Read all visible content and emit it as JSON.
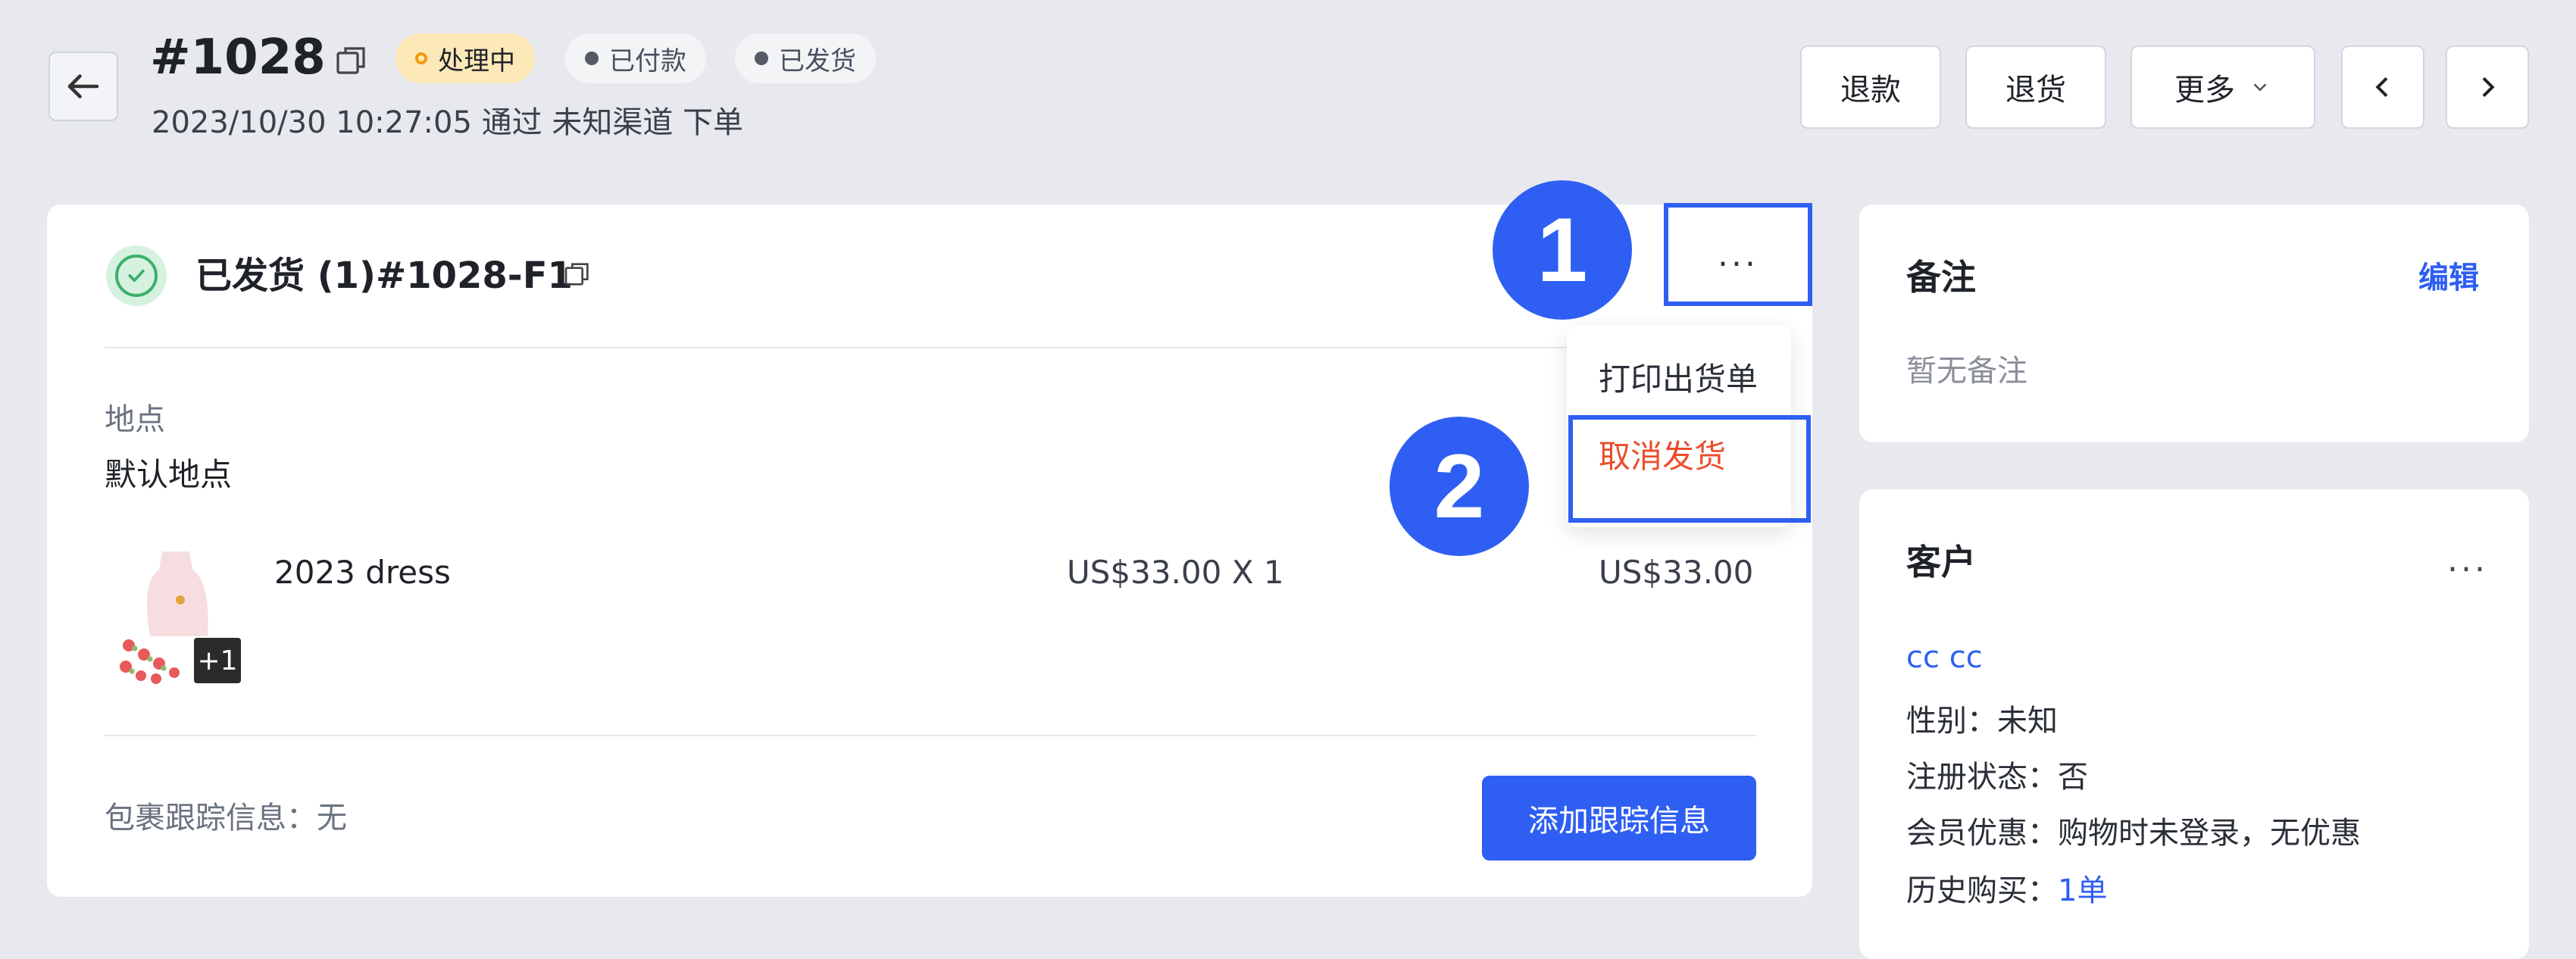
{
  "header": {
    "order_number": "#1028",
    "status_processing": "处理中",
    "status_paid": "已付款",
    "status_shipped": "已发货",
    "subline": "2023/10/30 10:27:05 通过 未知渠道 下单",
    "buttons": {
      "refund": "退款",
      "return": "退货",
      "more": "更多"
    }
  },
  "fulfillment": {
    "title": "已发货 (1)#1028-F1",
    "location_label": "地点",
    "location_value": "默认地点",
    "product": {
      "name": "2023 dress",
      "badge": "+1",
      "unit_price": "US$33.00 X 1",
      "total": "US$33.00"
    },
    "tracking_label": "包裹跟踪信息：无",
    "add_tracking_button": "添加跟踪信息"
  },
  "dropdown": {
    "trigger": "...",
    "items": [
      "打印出货单",
      "取消发货"
    ]
  },
  "annotations": {
    "step1": "1",
    "step2": "2"
  },
  "notes": {
    "title": "备注",
    "edit": "编辑",
    "empty": "暂无备注"
  },
  "customer": {
    "title": "客户",
    "more": "...",
    "name": "cc cc",
    "gender": "性别：未知",
    "registration": "注册状态：否",
    "member_discount": "会员优惠：购物时未登录，无优惠",
    "history_label": "历史购买：",
    "history_value": "1单"
  },
  "colors": {
    "accent": "#2f5ff2",
    "danger": "#ea4e2c",
    "success": "#3bb06b",
    "processing_bg": "#fde8b8"
  }
}
